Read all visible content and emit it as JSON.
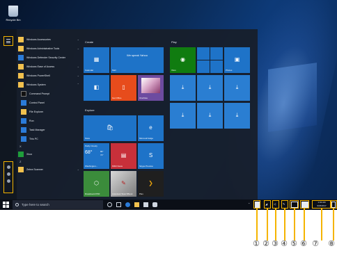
{
  "desktop": {
    "recycle_bin_label": "Recycle Bin"
  },
  "start_menu": {
    "app_list": [
      {
        "name": "Windows Accessories",
        "chevron": "⌄"
      },
      {
        "name": "Windows Administrative Tools",
        "chevron": "⌄"
      },
      {
        "name": "Windows Defender Security Center",
        "chevron": ""
      },
      {
        "name": "Windows Ease of Access",
        "chevron": "⌄"
      },
      {
        "name": "Windows PowerShell",
        "chevron": "⌄"
      },
      {
        "name": "Windows System",
        "chevron": "⌃"
      },
      {
        "name": "Command Prompt",
        "chevron": ""
      },
      {
        "name": "Control Panel",
        "chevron": ""
      },
      {
        "name": "File Explorer",
        "chevron": ""
      },
      {
        "name": "Run",
        "chevron": ""
      },
      {
        "name": "Task Manager",
        "chevron": ""
      },
      {
        "name": "This PC",
        "chevron": ""
      },
      {
        "name": "X",
        "chevron": ""
      },
      {
        "name": "Xbox",
        "chevron": ""
      },
      {
        "name": "Z",
        "chevron": ""
      },
      {
        "name": "Zebra Scanner",
        "chevron": "⌄"
      }
    ],
    "groups": {
      "create": "Create",
      "play": "Play",
      "explore": "Explore"
    },
    "tiles": {
      "calendar": "Calendar",
      "mail_banner": "We speak Yahoo",
      "mail": "Mail",
      "xbox": "Xbox",
      "photos": "Photos",
      "onenote": "OneNote",
      "get_office": "Get Office",
      "movies": "Movies & TV",
      "store": "Store",
      "edge": "Microsoft Edge",
      "weather_cond": "Partly Cloudy",
      "weather_temp": "68°",
      "weather_hi": "86°",
      "weather_lo": "72°",
      "weather_city": "Washington...",
      "news": "MSN News",
      "skype": "Skype Preview",
      "drawboard": "Drawboard PDF",
      "sketchbook": "Autodesk SketchBook",
      "plex": "Plex"
    }
  },
  "taskbar": {
    "search_placeholder": "Type here to search",
    "time": "1:03 AM",
    "date": "9/23/2017"
  },
  "callout_numbers": [
    "①",
    "②",
    "③",
    "④",
    "⑤",
    "⑥",
    "⑦",
    "⑧"
  ],
  "colors": {
    "callout": "#f5b400",
    "tile_blue": "#1e73c8",
    "office_orange": "#e74c1c",
    "news_red": "#c8303a"
  }
}
